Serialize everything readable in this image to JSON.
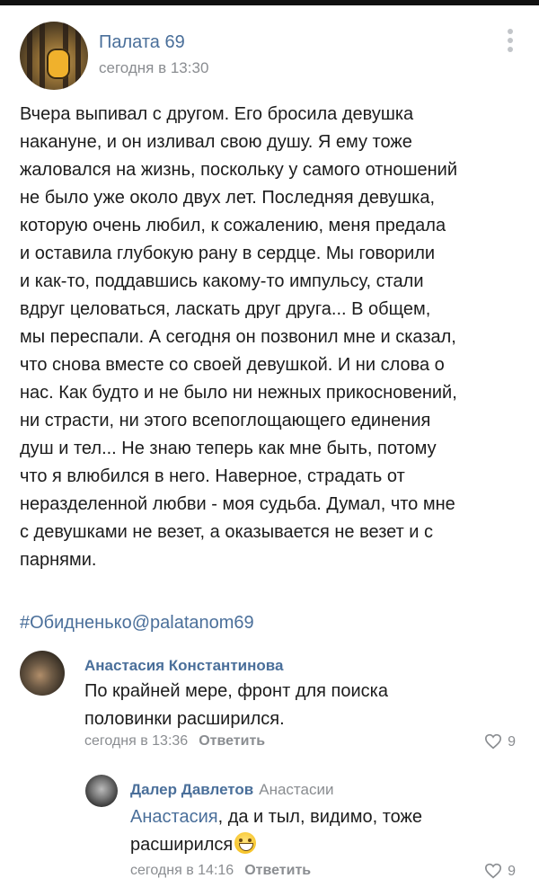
{
  "post": {
    "author": "Палата 69",
    "time": "сегодня в 13:30",
    "text": "Вчера выпивал с другом. Его бросила девушка\nнакануне, и он изливал свою душу. Я ему тоже\nжаловался на жизнь, поскольку у самого отношений\nне было уже около двух лет. Последняя девушка,\nкоторую очень любил, к сожалению, меня предала\nи оставила глубокую рану в сердце. Мы говорили\nи как-то, поддавшись какому-то импульсу, стали\nвдруг целоваться, ласкать друг друга... В общем,\nмы переспали. А сегодня он позвонил мне и сказал,\nчто снова вместе со своей девушкой. И ни слова о\nнас. Как будто и не было ни нежных прикосновений,\nни страсти, ни этого всепоглощающего единения\nдуш и тел... Не знаю теперь как мне быть, потому\nчто я влюбился в него. Наверное, страдать от\nнеразделенной любви - моя судьба. Думал, что мне\nс девушками не везет, а оказывается не везет и с\nпарнями.",
    "hashtag": "#Обидненько@palatanom69"
  },
  "comments": [
    {
      "author": "Анастасия Константинова",
      "text": "По крайней мере, фронт для поиска половинки расширился.",
      "time": "сегодня в 13:36",
      "reply_label": "Ответить",
      "likes": "9"
    },
    {
      "author": "Далер Давлетов",
      "reply_to": "Анастасии",
      "mention": "Анастасия",
      "text": ", да и тыл, видимо, тоже расширился",
      "emoji": "grinning-face",
      "time": "сегодня в 14:16",
      "reply_label": "Ответить",
      "likes": "9"
    }
  ],
  "colors": {
    "link": "#4a6f9a",
    "muted": "#8a8d91",
    "text": "#1c1c1c"
  }
}
